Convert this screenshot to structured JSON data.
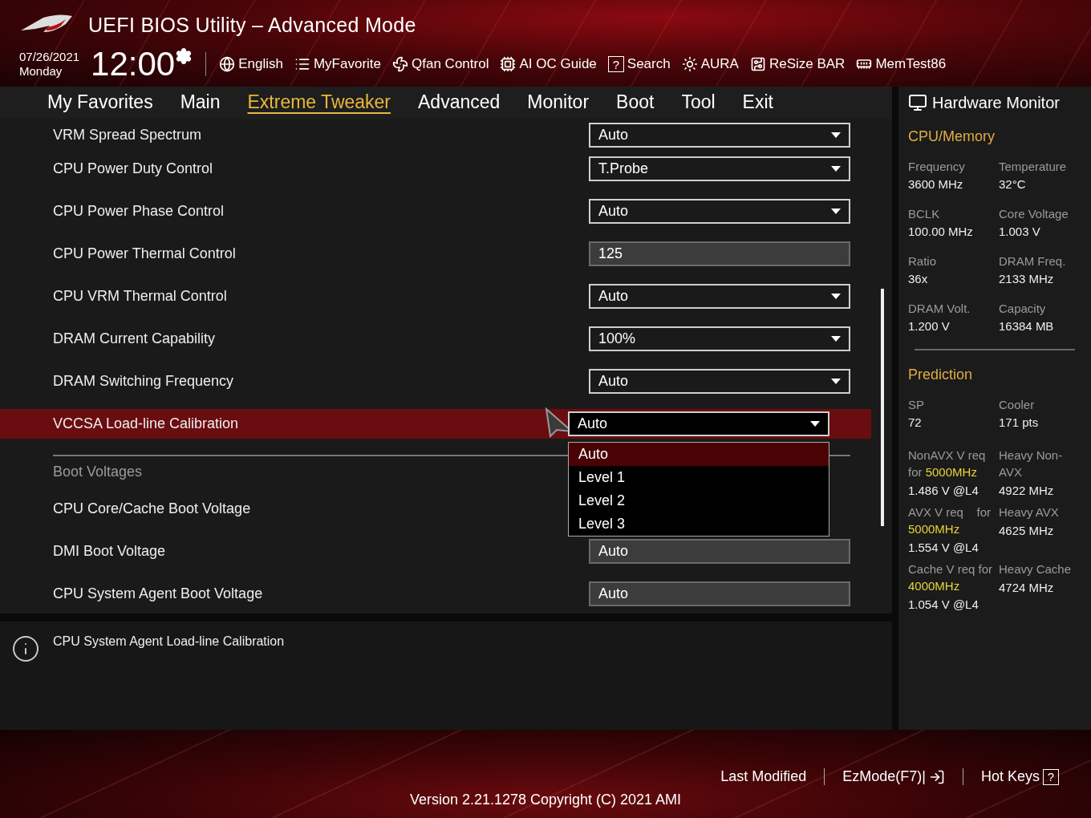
{
  "window": {
    "title": "UEFI BIOS Utility – Advanced Mode"
  },
  "clock": {
    "date": "07/26/2021",
    "day": "Monday",
    "time": "12:00"
  },
  "toolbar": [
    {
      "label": "English"
    },
    {
      "label": "MyFavorite"
    },
    {
      "label": "Qfan Control"
    },
    {
      "label": "AI OC Guide"
    },
    {
      "label": "Search",
      "glyph": "?"
    },
    {
      "label": "AURA"
    },
    {
      "label": "ReSize BAR"
    },
    {
      "label": "MemTest86"
    }
  ],
  "tabs": [
    {
      "label": "My Favorites",
      "selected": false
    },
    {
      "label": "Main",
      "selected": false
    },
    {
      "label": "Extreme Tweaker",
      "selected": true
    },
    {
      "label": "Advanced",
      "selected": false
    },
    {
      "label": "Monitor",
      "selected": false
    },
    {
      "label": "Boot",
      "selected": false
    },
    {
      "label": "Tool",
      "selected": false
    },
    {
      "label": "Exit",
      "selected": false
    }
  ],
  "settings": [
    {
      "kind": "dropdown",
      "label": "VRM Spread Spectrum",
      "value": "Auto",
      "selected": false,
      "partial": true
    },
    {
      "kind": "dropdown",
      "label": "CPU Power Duty Control",
      "value": "T.Probe",
      "selected": false
    },
    {
      "kind": "dropdown",
      "label": "CPU Power Phase Control",
      "value": "Auto",
      "selected": false
    },
    {
      "kind": "value",
      "label": "CPU Power Thermal Control",
      "value": "125",
      "selected": false
    },
    {
      "kind": "dropdown",
      "label": "CPU VRM Thermal Control",
      "value": "Auto",
      "selected": false
    },
    {
      "kind": "dropdown",
      "label": "DRAM Current Capability",
      "value": "100%",
      "selected": false
    },
    {
      "kind": "dropdown",
      "label": "DRAM Switching Frequency",
      "value": "Auto",
      "selected": false
    },
    {
      "kind": "dropdown",
      "label": "VCCSA Load-line Calibration",
      "value": "Auto",
      "selected": true,
      "options": [
        {
          "label": "Auto",
          "selected": true
        },
        {
          "label": "Level 1",
          "selected": false
        },
        {
          "label": "Level 2",
          "selected": false
        },
        {
          "label": "Level 3",
          "selected": false
        }
      ]
    },
    {
      "kind": "section",
      "label": "Boot Voltages"
    },
    {
      "kind": "value",
      "label": "CPU Core/Cache Boot Voltage",
      "selected": false
    },
    {
      "kind": "value",
      "label": "DMI Boot Voltage",
      "value": "Auto",
      "selected": false
    },
    {
      "kind": "value",
      "label": "CPU System Agent Boot Voltage",
      "value": "Auto",
      "selected": false
    }
  ],
  "help": {
    "text": "CPU System Agent Load-line Calibration"
  },
  "hardware_monitor": {
    "title": "Hardware Monitor",
    "sections": [
      {
        "title": "CPU/Memory",
        "items": [
          {
            "label": "Frequency",
            "value": "3600 MHz"
          },
          {
            "label": "Temperature",
            "value": "32°C"
          },
          {
            "label": "BCLK",
            "value": "100.00 MHz"
          },
          {
            "label": "Core Voltage",
            "value": "1.003 V"
          },
          {
            "label": "Ratio",
            "value": "36x"
          },
          {
            "label": "DRAM Freq.",
            "value": "2133 MHz"
          },
          {
            "label": "DRAM Volt.",
            "value": "1.200 V"
          },
          {
            "label": "Capacity",
            "value": "16384 MB"
          }
        ]
      },
      {
        "title": "Prediction",
        "items": [
          {
            "label": "SP",
            "value": "72"
          },
          {
            "label": "Cooler",
            "value": "171 pts"
          }
        ],
        "requirements": [
          {
            "label": "NonAVX V req for",
            "highlight": "5000MHz",
            "value": "1.486 V @L4",
            "label_2": "Heavy Non-AVX",
            "value_2": "4922 MHz"
          },
          {
            "label": "AVX V req    for",
            "highlight": "5000MHz",
            "value": "1.554 V @L4",
            "label_2": "Heavy AVX",
            "value_2": "4625 MHz"
          },
          {
            "label": "Cache V req for",
            "highlight": "4000MHz",
            "value": "1.054 V @L4",
            "label_2": "Heavy Cache",
            "value_2": "4724 MHz"
          }
        ]
      }
    ]
  },
  "footer": {
    "items": [
      {
        "label": "Last Modified"
      },
      {
        "label": "EzMode(F7)|"
      },
      {
        "label": "Hot Keys",
        "glyph": "?"
      }
    ],
    "version": "Version 2.21.1278 Copyright (C) 2021 AMI"
  }
}
